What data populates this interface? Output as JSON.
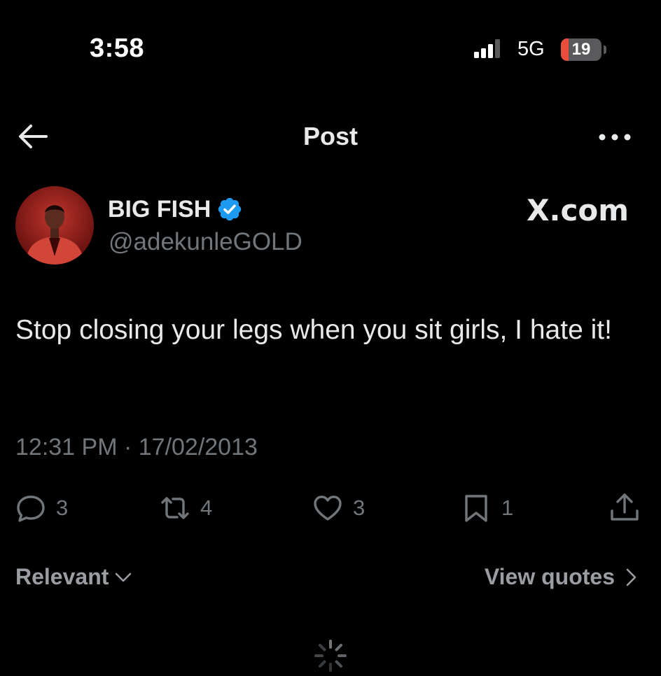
{
  "status_bar": {
    "time": "3:58",
    "network": "5G",
    "battery_level": "19",
    "battery_fraction": 0.19
  },
  "header": {
    "title": "Post",
    "back_icon": "arrow-left-icon",
    "more_icon": "more-horizontal-icon"
  },
  "post": {
    "author": {
      "display_name": "BIG FISH",
      "handle": "@adekunleGOLD",
      "verified": true,
      "avatar_icon": "avatar"
    },
    "watermark": "X.com",
    "text": "Stop closing your legs when you sit girls, I hate it!",
    "timestamp": "12:31 PM · 17/02/2013",
    "stats": {
      "replies": "3",
      "reposts": "4",
      "likes": "3",
      "bookmarks": "1"
    }
  },
  "replies_controls": {
    "sort_label": "Relevant",
    "quotes_label": "View quotes"
  },
  "colors": {
    "background": "#000000",
    "text_primary": "#e7e9ea",
    "text_secondary": "#71767b",
    "verified_blue": "#1d9bf0",
    "battery_red": "#eb4d3d"
  }
}
